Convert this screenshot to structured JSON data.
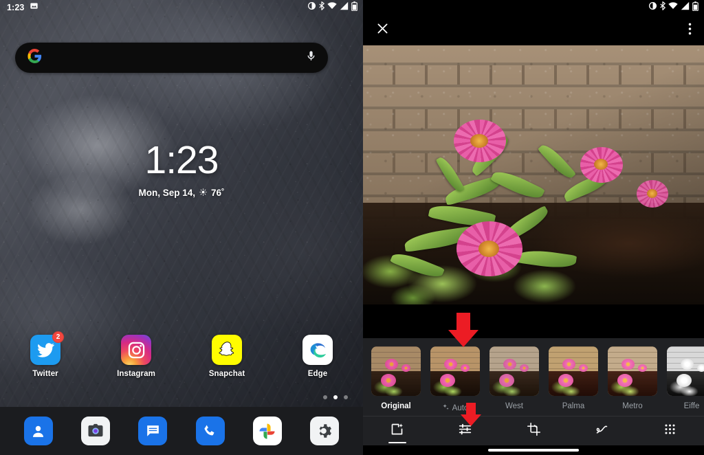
{
  "home": {
    "status_bar": {
      "time": "1:23",
      "notification_icons": [
        "image-icon"
      ],
      "system_icons": [
        "dnd-icon",
        "bluetooth-icon",
        "wifi-icon",
        "signal-icon",
        "battery-icon"
      ]
    },
    "search": {
      "placeholder": "",
      "value": "",
      "left_icon": "google-g-icon",
      "right_icon": "microphone-icon"
    },
    "clock_widget": {
      "time": "1:23",
      "date": "Mon, Sep 14,",
      "weather_icon": "sun-icon",
      "temperature": "76˚"
    },
    "apps": [
      {
        "label": "Twitter",
        "icon": "twitter-icon",
        "badge": "2"
      },
      {
        "label": "Instagram",
        "icon": "instagram-icon",
        "badge": ""
      },
      {
        "label": "Snapchat",
        "icon": "snapchat-icon",
        "badge": ""
      },
      {
        "label": "Edge",
        "icon": "edge-icon",
        "badge": ""
      }
    ],
    "page_dots": {
      "count": 3,
      "active_index": 1
    },
    "dock": [
      {
        "name": "contacts",
        "icon": "contacts-icon"
      },
      {
        "name": "camera",
        "icon": "camera-icon"
      },
      {
        "name": "messages",
        "icon": "messages-icon"
      },
      {
        "name": "phone",
        "icon": "phone-icon"
      },
      {
        "name": "photos",
        "icon": "google-photos-icon"
      },
      {
        "name": "settings",
        "icon": "settings-gear-icon"
      }
    ]
  },
  "editor": {
    "status_bar": {
      "system_icons": [
        "dnd-icon",
        "bluetooth-icon",
        "wifi-icon",
        "signal-icon",
        "battery-icon"
      ]
    },
    "topbar": {
      "close_icon": "close-x-icon",
      "menu_icon": "overflow-menu-icon"
    },
    "photo": {
      "description": "Pink zinnia flowers growing against a brick wall"
    },
    "filters": [
      {
        "label": "Original",
        "selected": true,
        "icon": ""
      },
      {
        "label": "Auto",
        "selected": false,
        "icon": "sparkle-icon"
      },
      {
        "label": "West",
        "selected": false,
        "icon": ""
      },
      {
        "label": "Palma",
        "selected": false,
        "icon": ""
      },
      {
        "label": "Metro",
        "selected": false,
        "icon": ""
      },
      {
        "label": "Eiffe",
        "selected": false,
        "icon": ""
      }
    ],
    "toolbar": [
      {
        "name": "suggestions",
        "icon": "photo-sparkle-icon",
        "selected": true
      },
      {
        "name": "adjust",
        "icon": "sliders-icon",
        "selected": false
      },
      {
        "name": "crop",
        "icon": "crop-rotate-icon",
        "selected": false
      },
      {
        "name": "markup",
        "icon": "markup-pen-icon",
        "selected": false
      },
      {
        "name": "more",
        "icon": "grid-dots-icon",
        "selected": false
      }
    ]
  },
  "annotations": [
    {
      "name": "arrow-to-auto-filter",
      "target": "Auto filter thumbnail",
      "color": "#ec1c24"
    },
    {
      "name": "arrow-to-adjust-tool",
      "target": "Adjust tool icon",
      "color": "#ec1c24"
    }
  ]
}
